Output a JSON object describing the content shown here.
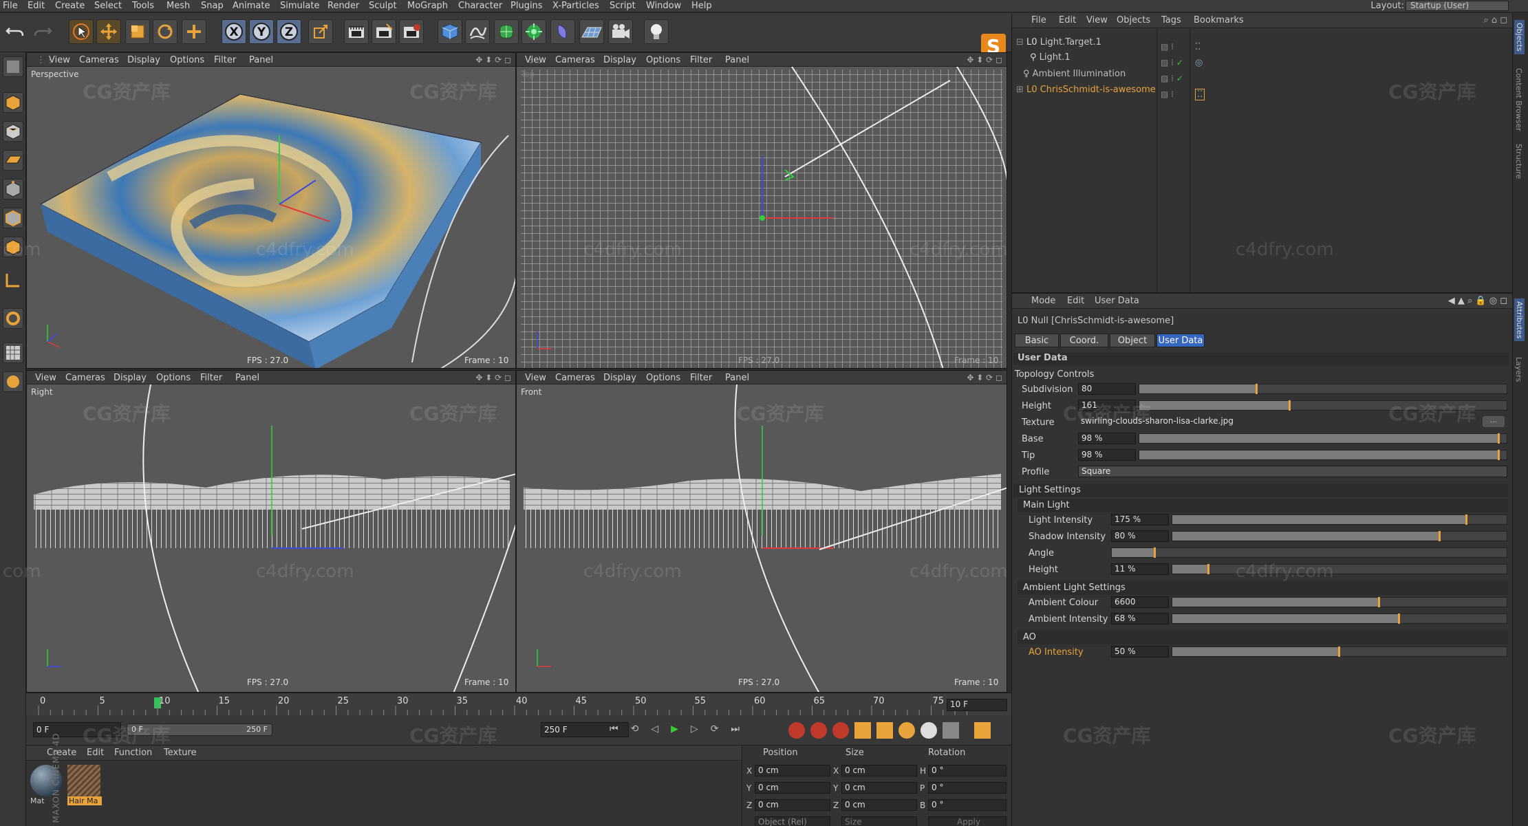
{
  "menubar": {
    "items": [
      "File",
      "Edit",
      "Create",
      "Select",
      "Tools",
      "Mesh",
      "Snap",
      "Animate",
      "Simulate",
      "Render",
      "Sculpt",
      "MoGraph",
      "Character",
      "Plugins",
      "X-Particles",
      "Script",
      "Window",
      "Help"
    ],
    "layout_label": "Layout:",
    "layout_value": "Startup (User)"
  },
  "viewport_menu": [
    "View",
    "Cameras",
    "Display",
    "Options",
    "Filter",
    "Panel"
  ],
  "viewports": {
    "perspective": {
      "name": "Perspective",
      "fps": "FPS : 27.0",
      "frame": "Frame : 10"
    },
    "top": {
      "name": "Top",
      "fps": "FPS : 27.0",
      "frame": "Frame : 10"
    },
    "right": {
      "name": "Right",
      "fps": "FPS : 27.0",
      "frame": "Frame : 10"
    },
    "front": {
      "name": "Front",
      "fps": "FPS : 27.0",
      "frame": "Frame : 10"
    }
  },
  "timeline": {
    "ticks": [
      "0",
      "5",
      "10",
      "15",
      "20",
      "25",
      "30",
      "35",
      "40",
      "45",
      "50",
      "55",
      "60",
      "65",
      "70",
      "75"
    ],
    "current_frame": "10 F",
    "start_field": "0 F",
    "range_start": "0 F",
    "range_end": "250 F",
    "end_field": "250 F",
    "playhead_frame": 10
  },
  "material_manager": {
    "menu": [
      "Create",
      "Edit",
      "Function",
      "Texture"
    ],
    "materials": [
      {
        "name": "Mat",
        "selected": false
      },
      {
        "name": "Hair Ma",
        "selected": true
      }
    ]
  },
  "coordinates": {
    "headers": [
      "Position",
      "Size",
      "Rotation"
    ],
    "rows": [
      {
        "axis": "X",
        "pos": "0 cm",
        "size_axis": "X",
        "size": "0 cm",
        "rot_axis": "H",
        "rot": "0 °"
      },
      {
        "axis": "Y",
        "pos": "0 cm",
        "size_axis": "Y",
        "size": "0 cm",
        "rot_axis": "P",
        "rot": "0 °"
      },
      {
        "axis": "Z",
        "pos": "0 cm",
        "size_axis": "Z",
        "size": "0 cm",
        "rot_axis": "B",
        "rot": "0 °"
      }
    ],
    "mode": "Object (Rel)",
    "size_mode": "Size",
    "apply": "Apply"
  },
  "object_manager": {
    "menu": [
      "File",
      "Edit",
      "View",
      "Objects",
      "Tags",
      "Bookmarks"
    ],
    "objects": [
      {
        "name": "Light.Target.1",
        "selected": false
      },
      {
        "name": "Light.1",
        "selected": false
      },
      {
        "name": "Ambient Illumination",
        "selected": false
      },
      {
        "name": "ChrisSchmidt-is-awesome",
        "selected": true
      }
    ]
  },
  "attribute_manager": {
    "menu": [
      "Mode",
      "Edit",
      "User Data"
    ],
    "object_title": "Null [ChrisSchmidt-is-awesome]",
    "tabs": [
      "Basic",
      "Coord.",
      "Object",
      "User Data"
    ],
    "active_tab": "User Data",
    "section_title": "User Data",
    "topology_group": "Topology Controls",
    "subdivision": {
      "label": "Subdivision",
      "value": "80",
      "level": 0.32
    },
    "height": {
      "label": "Height",
      "value": "161",
      "level": 0.41
    },
    "texture": {
      "label": "Texture",
      "value": "swirling-clouds-sharon-lisa-clarke.jpg"
    },
    "base": {
      "label": "Base",
      "value": "98 %",
      "level": 0.98
    },
    "tip": {
      "label": "Tip",
      "value": "98 %",
      "level": 0.98
    },
    "profile": {
      "label": "Profile",
      "value": "Square"
    },
    "light_settings": "Light Settings",
    "main_light": "Main Light",
    "light_intensity": {
      "label": "Light Intensity",
      "value": "175 %",
      "level": 0.88
    },
    "shadow_intensity": {
      "label": "Shadow Intensity",
      "value": "80 %",
      "level": 0.8
    },
    "angle": {
      "label": "Angle",
      "level": 0.11
    },
    "light_height": {
      "label": "Height",
      "value": "11 %",
      "level": 0.11
    },
    "ambient_group": "Ambient Light Settings",
    "ambient_colour": {
      "label": "Ambient Colour",
      "value": "6600",
      "level": 0.62
    },
    "ambient_intensity": {
      "label": "Ambient Intensity",
      "value": "68 %",
      "level": 0.68
    },
    "ao_group": "AO",
    "ao_intensity": {
      "label": "AO Intensity",
      "value": "50 %",
      "level": 0.5
    }
  },
  "right_tabs": [
    "Objects",
    "Content Browser",
    "Structure",
    "Attributes",
    "Layers"
  ],
  "side_text": "MAXON CINEMA 4D",
  "watermarks": {
    "cg": "CG资产库",
    "url": "c4dfry.com",
    "url_short": "com"
  },
  "colors": {
    "accent_orange": "#e8a33a",
    "selection_blue": "#3566c0",
    "viewport_bg": "#585858"
  }
}
